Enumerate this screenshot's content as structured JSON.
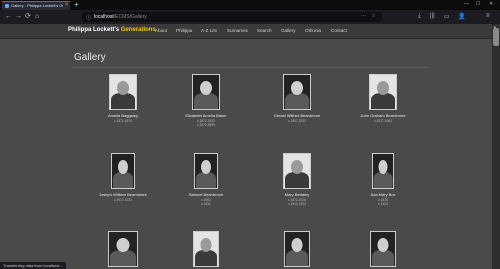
{
  "browser": {
    "tab_title": "Gallery - Philippa Lockett's Gen",
    "tab_close": "×",
    "new_tab": "+",
    "window_controls": [
      "—",
      "☐",
      "✕"
    ],
    "nav_icons": {
      "back": "←",
      "forward": "→",
      "reload": "⟳",
      "home": "⌂"
    },
    "url_host": "localhost",
    "url_path": "/ECMS/Gallery",
    "url_icons": "⋯ ☆",
    "toolbar_icons": [
      "⤓",
      "|||",
      "▭",
      "👤",
      "≡"
    ]
  },
  "site": {
    "brand_name": "Philippa Lockett's",
    "brand_accent": "Generations",
    "accent_color": "#f5c400",
    "menu": [
      "About",
      "Philippa",
      "A-Z List",
      "Surnames",
      "Search",
      "Gallery",
      "Othonia",
      "Contact"
    ]
  },
  "page": {
    "title": "Gallery"
  },
  "gallery": [
    {
      "name": "Amelia Baggaley",
      "life": "c.1872-1874"
    },
    {
      "name": "Elizabeth Amelia Baker",
      "life": "c.1872-1922\nc.1872-1899"
    },
    {
      "name": "Gerald Wilfred Beardmore",
      "life": "c.1907-1922"
    },
    {
      "name": "John Graham Beardmore",
      "life": "c.1917-1962"
    },
    {
      "name": "Joseph William Beardmore",
      "life": "c.1917-1931"
    },
    {
      "name": "Samuel Beardmore",
      "life": "c.1903\nc.1931"
    },
    {
      "name": "Mary Bettaley",
      "life": "c.1872-1926\nc.1910-1922"
    },
    {
      "name": "Ada Mary Box",
      "life": "c.1878\nc.1924"
    },
    {
      "name": "",
      "life": ""
    },
    {
      "name": "",
      "life": ""
    },
    {
      "name": "",
      "life": ""
    },
    {
      "name": "",
      "life": ""
    }
  ],
  "status_text": "Transferring data from localhost..."
}
